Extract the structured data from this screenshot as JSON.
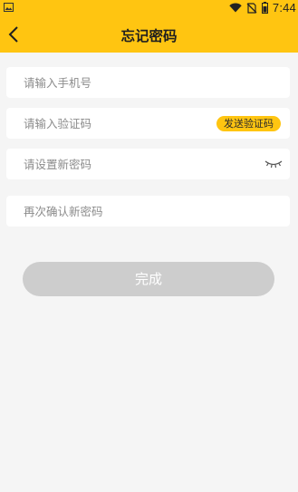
{
  "status_bar": {
    "time": "7:44",
    "icons": [
      "image-icon",
      "wifi-icon",
      "no-sim-icon",
      "battery-icon"
    ]
  },
  "header": {
    "title": "忘记密码",
    "back_icon": "chevron-left-icon"
  },
  "form": {
    "phone_placeholder": "请输入手机号",
    "code_placeholder": "请输入验证码",
    "send_code_label": "发送验证码",
    "new_password_placeholder": "请设置新密码",
    "password_toggle_icon": "eye-closed-icon",
    "confirm_password_placeholder": "再次确认新密码"
  },
  "submit": {
    "label": "完成"
  },
  "colors": {
    "accent": "#ffc511",
    "background": "#f5f5f5",
    "button_disabled": "#cdcdcd"
  }
}
